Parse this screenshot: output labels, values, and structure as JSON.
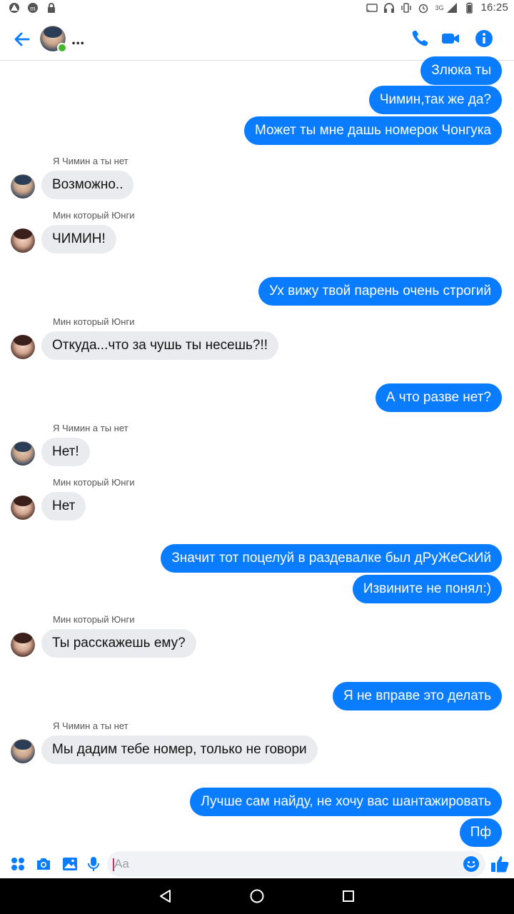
{
  "status_bar": {
    "time": "16:25",
    "network": "3G",
    "icons": [
      "alert-icon",
      "messenger-icon",
      "lock-icon",
      "cast-icon",
      "headset-icon",
      "vibrate-icon",
      "alarm-icon",
      "signal-icon",
      "battery-icon"
    ]
  },
  "header": {
    "title": "...",
    "icons": [
      "back-arrow-icon",
      "phone-icon",
      "video-icon",
      "info-icon"
    ],
    "accent": "#0a7cff"
  },
  "messages": [
    {
      "dir": "out",
      "text": "Злюка ты"
    },
    {
      "dir": "out",
      "text": "Чимин,так же да?"
    },
    {
      "dir": "out",
      "text": "Может ты мне дашь номерок Чонгука"
    },
    {
      "dir": "in",
      "sender": "Я Чимин а ты нет",
      "text": "Возможно.."
    },
    {
      "dir": "in",
      "sender": "Мин который Юнги",
      "text": "ЧИМИН!"
    },
    {
      "dir": "out",
      "text": "Ух вижу твой парень очень строгий"
    },
    {
      "dir": "in",
      "sender": "Мин который Юнги",
      "text": "Откуда...что за чушь ты несешь?!!"
    },
    {
      "dir": "out",
      "text": "А что разве нет?"
    },
    {
      "dir": "in",
      "sender": "Я Чимин а ты нет",
      "text": "Нет!"
    },
    {
      "dir": "in",
      "sender": "Мин который Юнги",
      "text": "Нет"
    },
    {
      "dir": "out",
      "text": "Значит тот поцелуй в раздевалке был дРуЖеСкИй"
    },
    {
      "dir": "out",
      "text": "Извините не понял:)"
    },
    {
      "dir": "in",
      "sender": "Мин который Юнги",
      "text": "Ты расскажешь ему?"
    },
    {
      "dir": "out",
      "text": "Я не вправе это делать"
    },
    {
      "dir": "in",
      "sender": "Я Чимин а ты нет",
      "text": "Мы дадим тебе номер, только не говори"
    },
    {
      "dir": "out",
      "text": "Лучше сам найду, не хочу вас шантажировать"
    },
    {
      "dir": "out",
      "text": "Пф"
    }
  ],
  "composer": {
    "placeholder": "Aa",
    "icons": [
      "apps-icon",
      "camera-icon",
      "gallery-icon",
      "mic-icon",
      "emoji-icon",
      "thumbs-up-icon"
    ]
  },
  "nav": {
    "icons": [
      "back-icon",
      "home-icon",
      "recents-icon"
    ]
  },
  "colors": {
    "outgoing_bubble": "#0a7cff",
    "incoming_bubble": "#eaebee",
    "online": "#42b72a"
  }
}
